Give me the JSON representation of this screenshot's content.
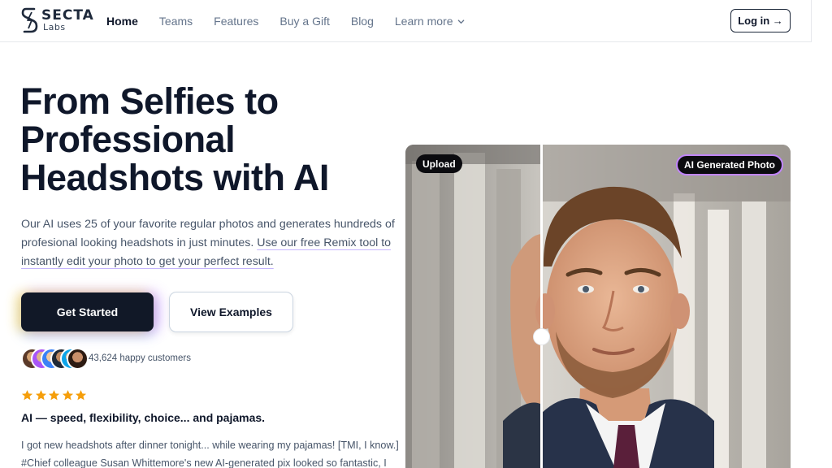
{
  "brand": {
    "name": "SECTA",
    "sub": "Labs"
  },
  "nav": {
    "items": [
      {
        "label": "Home",
        "active": true
      },
      {
        "label": "Teams"
      },
      {
        "label": "Features"
      },
      {
        "label": "Buy a Gift"
      },
      {
        "label": "Blog"
      }
    ],
    "more_label": "Learn more",
    "login_label": "Log in →"
  },
  "hero": {
    "headline_line1": "From Selfies to",
    "headline_line2": "Professional",
    "headline_line3": "Headshots with AI",
    "lead_plain": "Our AI uses 25 of your favorite regular photos and generates hundreds of profesional looking headshots in just minutes. ",
    "lead_link": "Use our free Remix tool to instantly edit your photo to get your perfect result.",
    "primary_cta": "Get Started",
    "secondary_cta": "View Examples",
    "customers_text": "43,624 happy customers"
  },
  "review": {
    "rating": 5,
    "title": "AI — speed, flexibility, choice... and pajamas.",
    "body": "I got new headshots after dinner tonight... while wearing my pajamas! [TMI, I know.] #Chief colleague Susan Whittemore's new AI-generated pix looked so fantastic, I"
  },
  "comparison": {
    "left_label": "Upload",
    "right_label": "AI Generated Photo"
  },
  "colors": {
    "primary_button": "#111827",
    "star": "#f59e0b",
    "ai_badge_border": "#c084fc"
  },
  "icons": [
    "logo-icon",
    "chevron-down-icon",
    "star-icon",
    "slider-handle-icon"
  ]
}
